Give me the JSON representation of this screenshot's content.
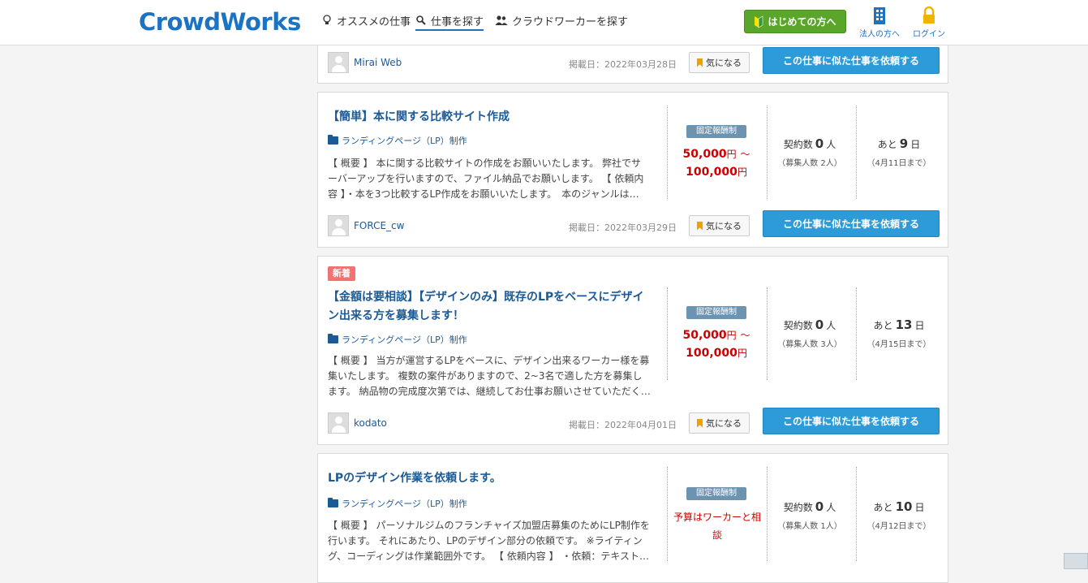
{
  "header": {
    "logo": "CrowdWorks",
    "nav": {
      "recommended": "オススメの仕事",
      "find_jobs": "仕事を探す",
      "find_workers": "クラウドワーカーを探す"
    },
    "beginner_button": "はじめての方へ",
    "corporate_link": "法人の方へ",
    "login_link": "ログイン"
  },
  "cards": [
    {
      "client": "Mirai Web",
      "posted": "掲載日：2022年03月28日",
      "fav_label": "気になる",
      "similar_label": "この仕事に似た仕事を依頼する"
    },
    {
      "title": "【簡単】本に関する比較サイト作成",
      "category": "ランディングページ（LP）制作",
      "description": "【 概要 】 本に関する比較サイトの作成をお願いいたします。 弊社でサーバーアップを行いますので、ファイル納品でお願いします。 【 依頼内容 】・本を3つ比較するLP作成をお願いいたします。　本のジャンルは…",
      "pay_type": "固定報酬制",
      "price_min": "50,000",
      "price_max": "100,000",
      "yen": "円",
      "tilde": "～",
      "contracts_label": "契約数",
      "contracts": "0",
      "contracts_unit": "人",
      "recruit": "（募集人数 2人）",
      "remaining_prefix": "あと",
      "remaining_days": "9",
      "remaining_unit": "日",
      "deadline": "（4月11日まで）",
      "client": "FORCE_cw",
      "posted": "掲載日：2022年03月29日",
      "fav_label": "気になる",
      "similar_label": "この仕事に似た仕事を依頼する"
    },
    {
      "badge": "新着",
      "title": "【金額は要相談】【デザインのみ】既存のLPをベースにデザイン出来る方を募集します！",
      "category": "ランディングページ（LP）制作",
      "description": "【 概要 】 当方が運営するLPをベースに、デザイン出来るワーカー様を募集いたします。 複数の案件がありますので、2~3名で適した方を募集します。 納品物の完成度次第では、継続してお仕事お願いさせていただく…",
      "pay_type": "固定報酬制",
      "price_min": "50,000",
      "price_max": "100,000",
      "yen": "円",
      "tilde": "～",
      "contracts_label": "契約数",
      "contracts": "0",
      "contracts_unit": "人",
      "recruit": "（募集人数 3人）",
      "remaining_prefix": "あと",
      "remaining_days": "13",
      "remaining_unit": "日",
      "deadline": "（4月15日まで）",
      "client": "kodato",
      "posted": "掲載日：2022年04月01日",
      "fav_label": "気になる",
      "similar_label": "この仕事に似た仕事を依頼する"
    },
    {
      "title": "LPのデザイン作業を依頼します。",
      "category": "ランディングページ（LP）制作",
      "description": "【 概要 】 パーソナルジムのフランチャイズ加盟店募集のためにLP制作を行います。 それにあたり、LPのデザイン部分の依頼です。 ※ライティング、コーディングは作業範囲外です。 【 依頼内容 】 ・依頼：テキスト…",
      "pay_type": "固定報酬制",
      "price_text": "予算はワーカーと相談",
      "contracts_label": "契約数",
      "contracts": "0",
      "contracts_unit": "人",
      "recruit": "（募集人数 1人）",
      "remaining_prefix": "あと",
      "remaining_days": "10",
      "remaining_unit": "日",
      "deadline": "（4月12日まで）"
    }
  ]
}
